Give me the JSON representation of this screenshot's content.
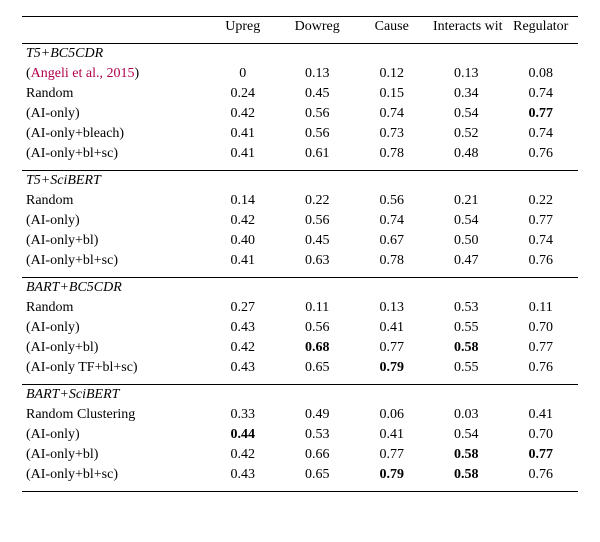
{
  "columns": {
    "c1": "Upreg",
    "c2": "Dowreg",
    "c3": "Cause",
    "c4": "Interacts with",
    "c5": "Regulator"
  },
  "sections": [
    {
      "title": "T5+BC5CDR",
      "rows": [
        {
          "label_pre": "(",
          "label_cite": "Angeli et al., 2015",
          "label_post": ")",
          "v": [
            "0",
            "0.13",
            "0.12",
            "0.13",
            "0.08"
          ],
          "bold": [
            false,
            false,
            false,
            false,
            false
          ],
          "is_cite": true
        },
        {
          "label": "Random",
          "v": [
            "0.24",
            "0.45",
            "0.15",
            "0.34",
            "0.74"
          ],
          "bold": [
            false,
            false,
            false,
            false,
            false
          ]
        },
        {
          "label": "(AI-only)",
          "v": [
            "0.42",
            "0.56",
            "0.74",
            "0.54",
            "0.77"
          ],
          "bold": [
            false,
            false,
            false,
            false,
            true
          ]
        },
        {
          "label": "(AI-only+bleach)",
          "v": [
            "0.41",
            "0.56",
            "0.73",
            "0.52",
            "0.74"
          ],
          "bold": [
            false,
            false,
            false,
            false,
            false
          ]
        },
        {
          "label": "(AI-only+bl+sc)",
          "v": [
            "0.41",
            "0.61",
            "0.78",
            "0.48",
            "0.76"
          ],
          "bold": [
            false,
            false,
            false,
            false,
            false
          ]
        }
      ]
    },
    {
      "title": "T5+SciBERT",
      "rows": [
        {
          "label": "Random",
          "v": [
            "0.14",
            "0.22",
            "0.56",
            "0.21",
            "0.22"
          ],
          "bold": [
            false,
            false,
            false,
            false,
            false
          ]
        },
        {
          "label": "(AI-only)",
          "v": [
            "0.42",
            "0.56",
            "0.74",
            "0.54",
            "0.77"
          ],
          "bold": [
            false,
            false,
            false,
            false,
            false
          ]
        },
        {
          "label": "(AI-only+bl)",
          "v": [
            "0.40",
            "0.45",
            "0.67",
            "0.50",
            "0.74"
          ],
          "bold": [
            false,
            false,
            false,
            false,
            false
          ]
        },
        {
          "label": "(AI-only+bl+sc)",
          "v": [
            "0.41",
            "0.63",
            "0.78",
            "0.47",
            "0.76"
          ],
          "bold": [
            false,
            false,
            false,
            false,
            false
          ]
        }
      ]
    },
    {
      "title": "BART+BC5CDR",
      "rows": [
        {
          "label": "Random",
          "v": [
            "0.27",
            "0.11",
            "0.13",
            "0.53",
            "0.11"
          ],
          "bold": [
            false,
            false,
            false,
            false,
            false
          ]
        },
        {
          "label": "(AI-only)",
          "v": [
            "0.43",
            "0.56",
            "0.41",
            "0.55",
            "0.70"
          ],
          "bold": [
            false,
            false,
            false,
            false,
            false
          ]
        },
        {
          "label": "(AI-only+bl)",
          "v": [
            "0.42",
            "0.68",
            "0.77",
            "0.58",
            "0.77"
          ],
          "bold": [
            false,
            true,
            false,
            true,
            false
          ]
        },
        {
          "label": "(AI-only TF+bl+sc)",
          "v": [
            "0.43",
            "0.65",
            "0.79",
            "0.55",
            "0.76"
          ],
          "bold": [
            false,
            false,
            true,
            false,
            false
          ]
        }
      ]
    },
    {
      "title": "BART+SciBERT",
      "rows": [
        {
          "label": "Random Clustering",
          "v": [
            "0.33",
            "0.49",
            "0.06",
            "0.03",
            "0.41"
          ],
          "bold": [
            false,
            false,
            false,
            false,
            false
          ]
        },
        {
          "label": "(AI-only)",
          "v": [
            "0.44",
            "0.53",
            "0.41",
            "0.54",
            "0.70"
          ],
          "bold": [
            true,
            false,
            false,
            false,
            false
          ]
        },
        {
          "label": "(AI-only+bl)",
          "v": [
            "0.42",
            "0.66",
            "0.77",
            "0.58",
            "0.77"
          ],
          "bold": [
            false,
            false,
            false,
            true,
            true
          ]
        },
        {
          "label": "(AI-only+bl+sc)",
          "v": [
            "0.43",
            "0.65",
            "0.79",
            "0.58",
            "0.76"
          ],
          "bold": [
            false,
            false,
            true,
            true,
            false
          ]
        }
      ]
    }
  ],
  "chart_data": {
    "type": "table",
    "columns": [
      "Upreg",
      "Dowreg",
      "Cause",
      "Interacts with",
      "Regulator"
    ],
    "groups": [
      {
        "name": "T5+BC5CDR",
        "rows": [
          {
            "method": "(Angeli et al., 2015)",
            "values": [
              0,
              0.13,
              0.12,
              0.13,
              0.08
            ]
          },
          {
            "method": "Random",
            "values": [
              0.24,
              0.45,
              0.15,
              0.34,
              0.74
            ]
          },
          {
            "method": "(AI-only)",
            "values": [
              0.42,
              0.56,
              0.74,
              0.54,
              0.77
            ]
          },
          {
            "method": "(AI-only+bleach)",
            "values": [
              0.41,
              0.56,
              0.73,
              0.52,
              0.74
            ]
          },
          {
            "method": "(AI-only+bl+sc)",
            "values": [
              0.41,
              0.61,
              0.78,
              0.48,
              0.76
            ]
          }
        ]
      },
      {
        "name": "T5+SciBERT",
        "rows": [
          {
            "method": "Random",
            "values": [
              0.14,
              0.22,
              0.56,
              0.21,
              0.22
            ]
          },
          {
            "method": "(AI-only)",
            "values": [
              0.42,
              0.56,
              0.74,
              0.54,
              0.77
            ]
          },
          {
            "method": "(AI-only+bl)",
            "values": [
              0.4,
              0.45,
              0.67,
              0.5,
              0.74
            ]
          },
          {
            "method": "(AI-only+bl+sc)",
            "values": [
              0.41,
              0.63,
              0.78,
              0.47,
              0.76
            ]
          }
        ]
      },
      {
        "name": "BART+BC5CDR",
        "rows": [
          {
            "method": "Random",
            "values": [
              0.27,
              0.11,
              0.13,
              0.53,
              0.11
            ]
          },
          {
            "method": "(AI-only)",
            "values": [
              0.43,
              0.56,
              0.41,
              0.55,
              0.7
            ]
          },
          {
            "method": "(AI-only+bl)",
            "values": [
              0.42,
              0.68,
              0.77,
              0.58,
              0.77
            ]
          },
          {
            "method": "(AI-only TF+bl+sc)",
            "values": [
              0.43,
              0.65,
              0.79,
              0.55,
              0.76
            ]
          }
        ]
      },
      {
        "name": "BART+SciBERT",
        "rows": [
          {
            "method": "Random Clustering",
            "values": [
              0.33,
              0.49,
              0.06,
              0.03,
              0.41
            ]
          },
          {
            "method": "(AI-only)",
            "values": [
              0.44,
              0.53,
              0.41,
              0.54,
              0.7
            ]
          },
          {
            "method": "(AI-only+bl)",
            "values": [
              0.42,
              0.66,
              0.77,
              0.58,
              0.77
            ]
          },
          {
            "method": "(AI-only+bl+sc)",
            "values": [
              0.43,
              0.65,
              0.79,
              0.58,
              0.76
            ]
          }
        ]
      }
    ]
  }
}
